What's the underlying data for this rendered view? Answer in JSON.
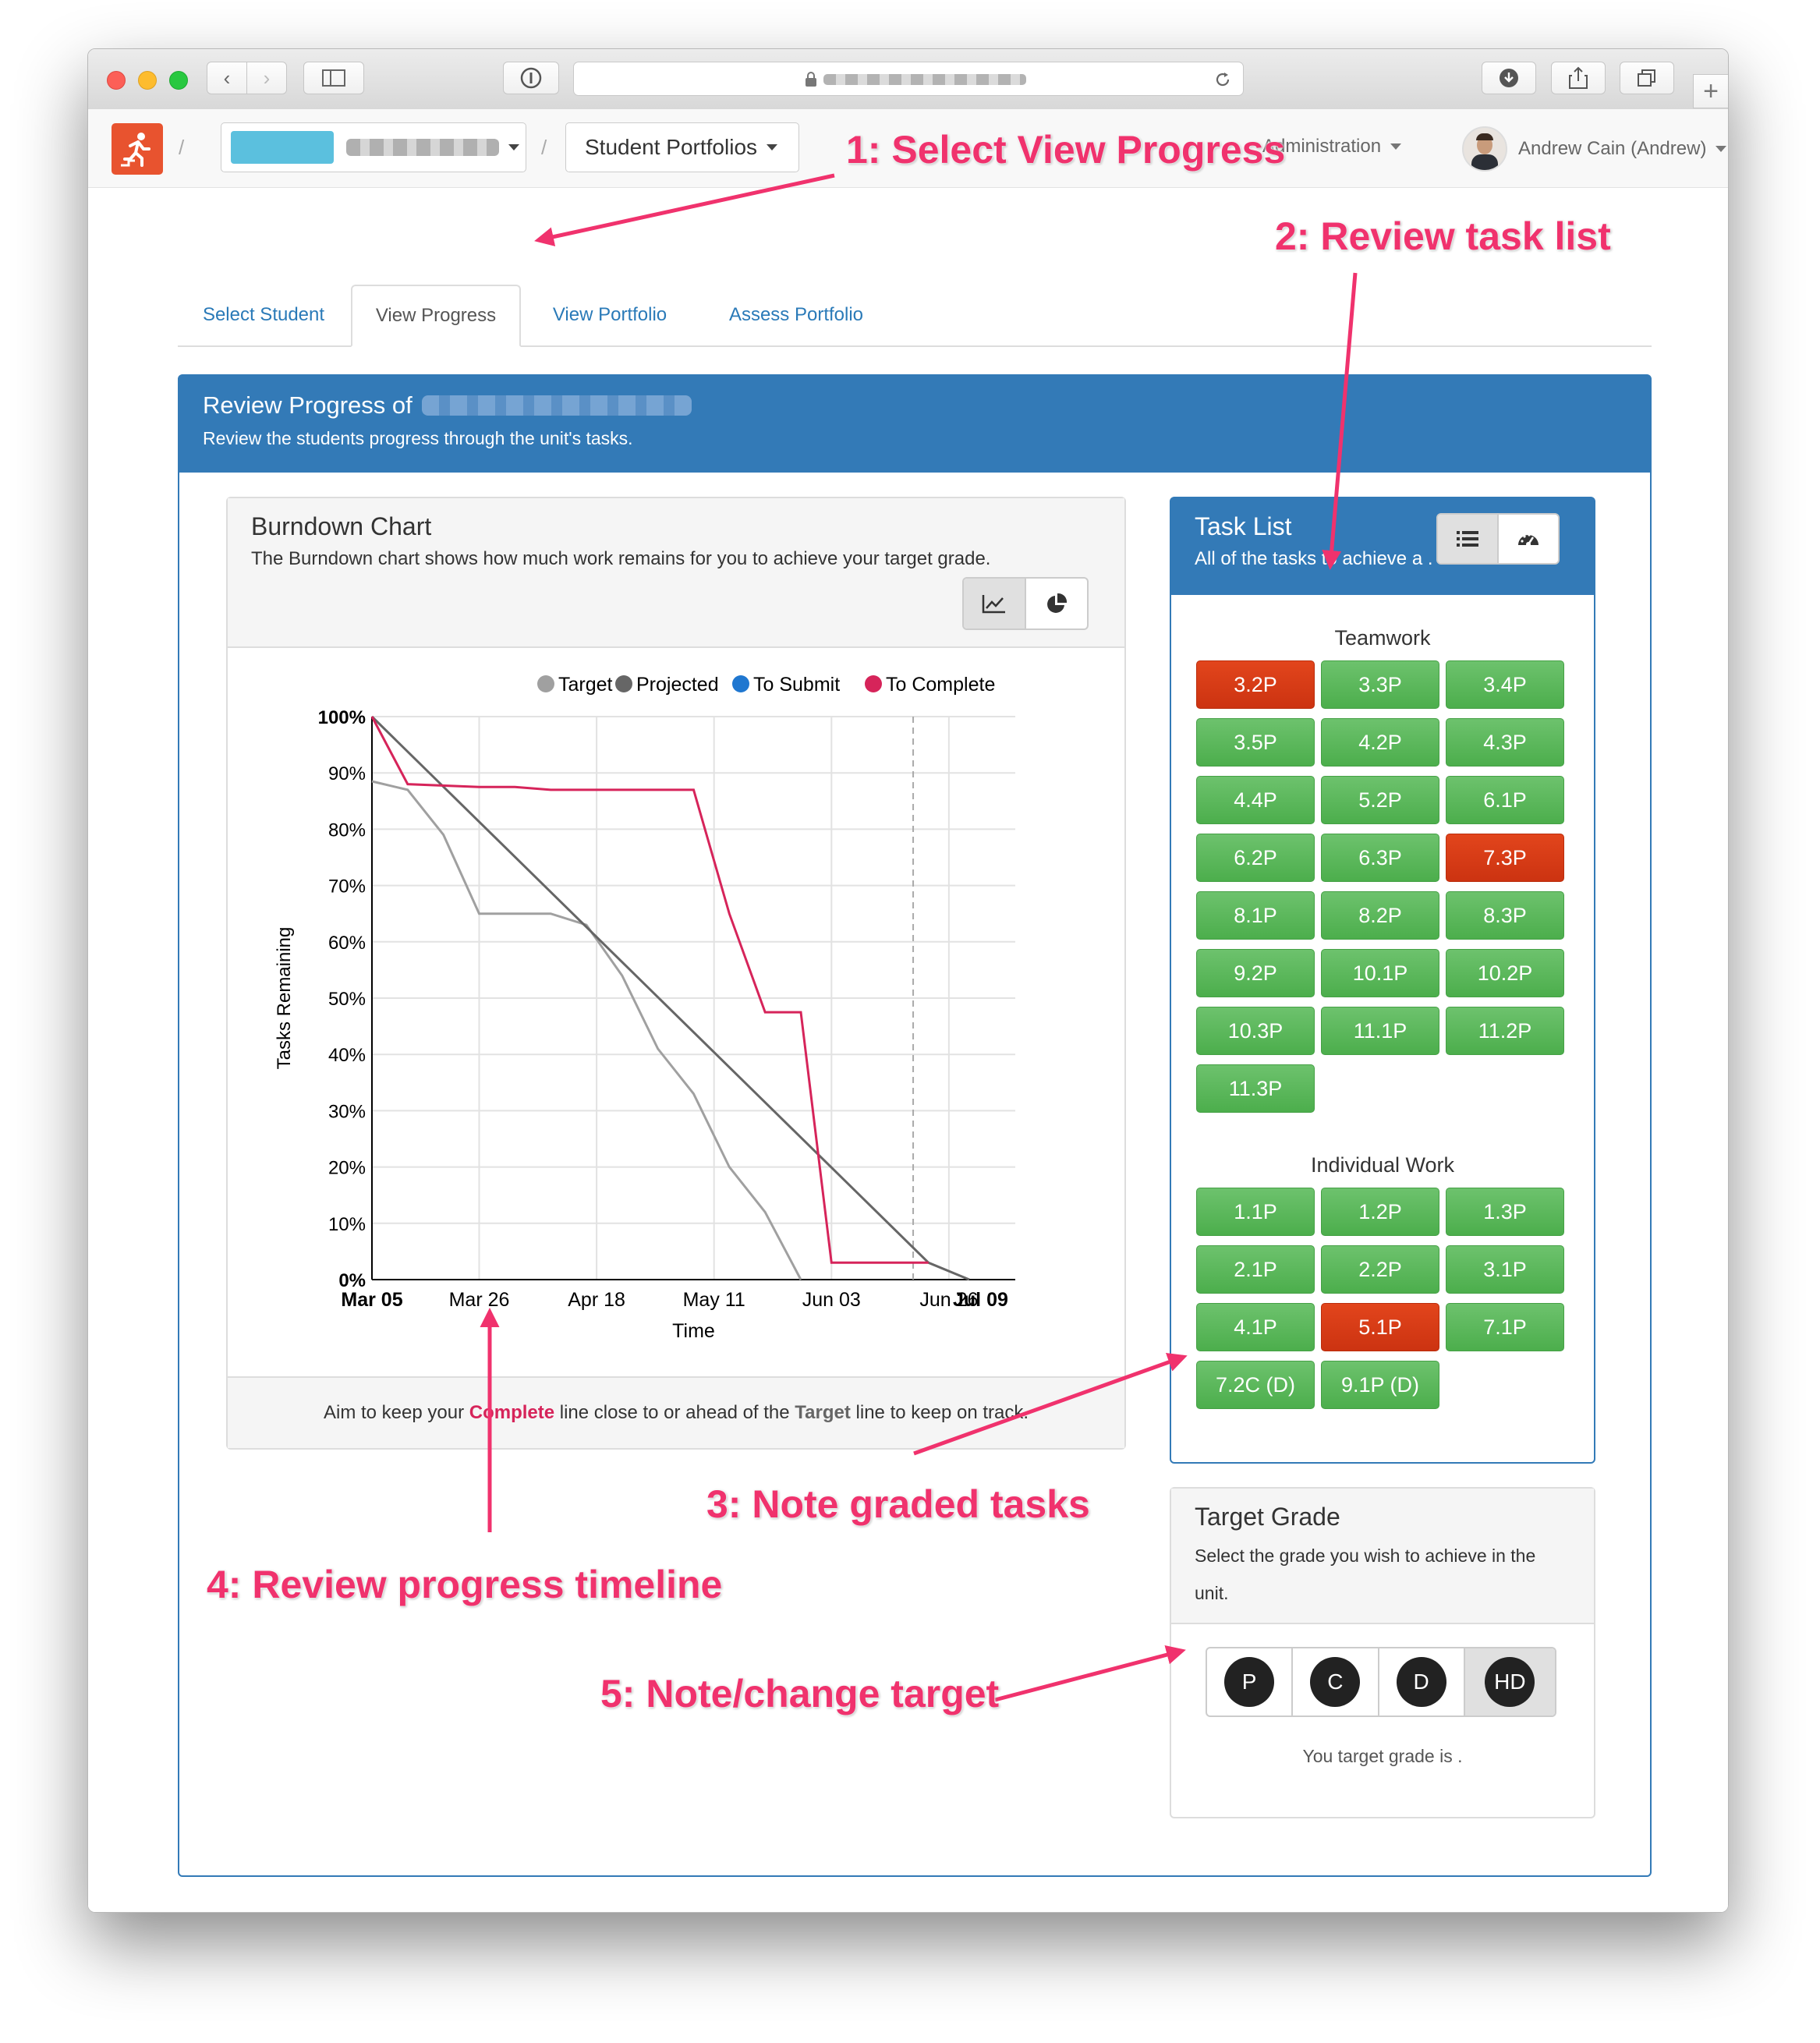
{
  "colors": {
    "primary": "#337ab7",
    "task_green": "#5cb85c",
    "task_red": "#d9381a",
    "annotation": "#f0326d",
    "target_line": "#a0a0a0",
    "projected_line": "#666666",
    "complete_line": "#d6245a"
  },
  "browser": {
    "url_blurred": true
  },
  "navbar": {
    "unit_selector_blurred": true,
    "section_dropdown": "Student Portfolios",
    "admin_label": "Administration",
    "user_name": "Andrew Cain (Andrew)"
  },
  "tabs": [
    "Select Student",
    "View Progress",
    "View Portfolio",
    "Assess Portfolio"
  ],
  "review": {
    "title": "Review Progress of",
    "subtitle": "Review the students progress through the unit's tasks."
  },
  "burndown": {
    "title": "Burndown Chart",
    "description": "The Burndown chart shows how much work remains for you to achieve your target grade.",
    "footer_prefix": "Aim to keep your ",
    "footer_complete": "Complete",
    "footer_middle": " line close to or ahead of the ",
    "footer_target": "Target",
    "footer_suffix": " line to keep on track."
  },
  "chart_data": {
    "type": "line",
    "xlabel": "Time",
    "ylabel": "Tasks Remaining",
    "ylim": [
      0,
      100
    ],
    "y_ticks": [
      "100%",
      "90%",
      "80%",
      "70%",
      "60%",
      "50%",
      "40%",
      "30%",
      "20%",
      "10%",
      "0%"
    ],
    "x_ticks": [
      "Mar 05",
      "Mar 26",
      "Apr 18",
      "May 11",
      "Jun 03",
      "Jun 26",
      "Jul 09"
    ],
    "bold_x_ticks": [
      "Mar 05",
      "Jul 09"
    ],
    "grid": true,
    "legend_position": "top",
    "legend": [
      {
        "name": "Target",
        "color": "#a0a0a0"
      },
      {
        "name": "Projected",
        "color": "#666666"
      },
      {
        "name": "To Submit",
        "color": "#1f77d0"
      },
      {
        "name": "To Complete",
        "color": "#d6245a"
      }
    ],
    "series": [
      {
        "name": "Target",
        "color": "#a0a0a0",
        "points": [
          [
            "Mar 05",
            88.5
          ],
          [
            "Mar 12",
            87
          ],
          [
            "Mar 19",
            79
          ],
          [
            "Mar 26",
            65
          ],
          [
            "Apr 02",
            65
          ],
          [
            "Apr 09",
            65
          ],
          [
            "Apr 16",
            63
          ],
          [
            "Apr 23",
            54
          ],
          [
            "Apr 30",
            41
          ],
          [
            "May 07",
            33
          ],
          [
            "May 14",
            20
          ],
          [
            "May 21",
            12
          ],
          [
            "May 28",
            0
          ]
        ]
      },
      {
        "name": "Projected",
        "color": "#666666",
        "points": [
          [
            "Mar 05",
            100
          ],
          [
            "Jun 22",
            3
          ],
          [
            "Jun 30",
            0
          ]
        ]
      },
      {
        "name": "To Complete",
        "color": "#d6245a",
        "points": [
          [
            "Mar 05",
            100
          ],
          [
            "Mar 12",
            88
          ],
          [
            "Mar 26",
            87.5
          ],
          [
            "Apr 02",
            87.5
          ],
          [
            "Apr 09",
            87
          ],
          [
            "May 07",
            87
          ],
          [
            "May 14",
            65
          ],
          [
            "May 21",
            47.5
          ],
          [
            "May 28",
            47.5
          ],
          [
            "Jun 03",
            3
          ],
          [
            "Jun 22",
            3
          ]
        ]
      }
    ],
    "marker_line": "Jun 19"
  },
  "task_list": {
    "title": "Task List",
    "subtitle": "All of the tasks to achieve a .",
    "groups": [
      {
        "name": "Teamwork",
        "tasks": [
          {
            "label": "3.2P",
            "status": "red"
          },
          {
            "label": "3.3P",
            "status": "green"
          },
          {
            "label": "3.4P",
            "status": "green"
          },
          {
            "label": "3.5P",
            "status": "green"
          },
          {
            "label": "4.2P",
            "status": "green"
          },
          {
            "label": "4.3P",
            "status": "green"
          },
          {
            "label": "4.4P",
            "status": "green"
          },
          {
            "label": "5.2P",
            "status": "green"
          },
          {
            "label": "6.1P",
            "status": "green"
          },
          {
            "label": "6.2P",
            "status": "green"
          },
          {
            "label": "6.3P",
            "status": "green"
          },
          {
            "label": "7.3P",
            "status": "red"
          },
          {
            "label": "8.1P",
            "status": "green"
          },
          {
            "label": "8.2P",
            "status": "green"
          },
          {
            "label": "8.3P",
            "status": "green"
          },
          {
            "label": "9.2P",
            "status": "green"
          },
          {
            "label": "10.1P",
            "status": "green"
          },
          {
            "label": "10.2P",
            "status": "green"
          },
          {
            "label": "10.3P",
            "status": "green"
          },
          {
            "label": "11.1P",
            "status": "green"
          },
          {
            "label": "11.2P",
            "status": "green"
          },
          {
            "label": "11.3P",
            "status": "green"
          }
        ]
      },
      {
        "name": "Individual Work",
        "tasks": [
          {
            "label": "1.1P",
            "status": "green"
          },
          {
            "label": "1.2P",
            "status": "green"
          },
          {
            "label": "1.3P",
            "status": "green"
          },
          {
            "label": "2.1P",
            "status": "green"
          },
          {
            "label": "2.2P",
            "status": "green"
          },
          {
            "label": "3.1P",
            "status": "green"
          },
          {
            "label": "4.1P",
            "status": "green"
          },
          {
            "label": "5.1P",
            "status": "red"
          },
          {
            "label": "7.1P",
            "status": "green"
          },
          {
            "label": "7.2C (D)",
            "status": "green"
          },
          {
            "label": "9.1P (D)",
            "status": "green"
          }
        ]
      }
    ]
  },
  "target_grade": {
    "title": "Target Grade",
    "description": "Select the grade you wish to achieve in the unit.",
    "options": [
      "P",
      "C",
      "D",
      "HD"
    ],
    "selected": "HD",
    "status_text": "You target grade is ."
  },
  "annotations": {
    "a1": "1: Select View Progress",
    "a2": "2: Review task list",
    "a3": "3: Note graded tasks",
    "a4": "4: Review progress timeline",
    "a5": "5: Note/change target"
  }
}
